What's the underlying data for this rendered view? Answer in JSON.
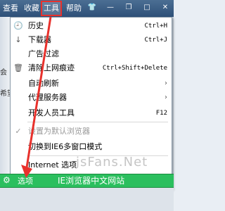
{
  "menubar": {
    "items": [
      {
        "label": "查看"
      },
      {
        "label": "收藏"
      },
      {
        "label": "工具"
      },
      {
        "label": "帮助"
      }
    ],
    "window_icons": [
      "shirt-icon",
      "minimize-icon",
      "restore-icon",
      "close-icon"
    ]
  },
  "left_fragments": [
    "会",
    "希望"
  ],
  "dropdown": {
    "items": [
      {
        "icon": "history-icon",
        "label": "历史",
        "shortcut": "Ctrl+H"
      },
      {
        "icon": "download-icon",
        "label": "下载器",
        "shortcut": "Ctrl+J"
      },
      {
        "icon": "",
        "label": "广告过滤",
        "shortcut": ""
      },
      {
        "icon": "trash-icon",
        "label": "清除上网痕迹",
        "shortcut": "Ctrl+Shift+Delete"
      },
      {
        "icon": "",
        "label": "自动刷新",
        "arrow": "›"
      },
      {
        "icon": "",
        "label": "代理服务器",
        "arrow": "›"
      },
      {
        "icon": "",
        "label": "开发人员工具",
        "shortcut": "F12"
      },
      {
        "icon": "check-icon",
        "label": "设置为默认浏览器",
        "disabled": true
      },
      {
        "icon": "",
        "label": "切换到IE6多窗口模式"
      },
      {
        "icon": "",
        "label": "Internet 选项"
      },
      {
        "icon": "gear-icon",
        "label": "选项",
        "selected": true
      }
    ]
  },
  "watermark": "jsFans.Net",
  "highlight_caption": "IE浏览器中文网站",
  "colors": {
    "accent_red": "#e8312c",
    "selected_green": "#2bbf5e"
  }
}
